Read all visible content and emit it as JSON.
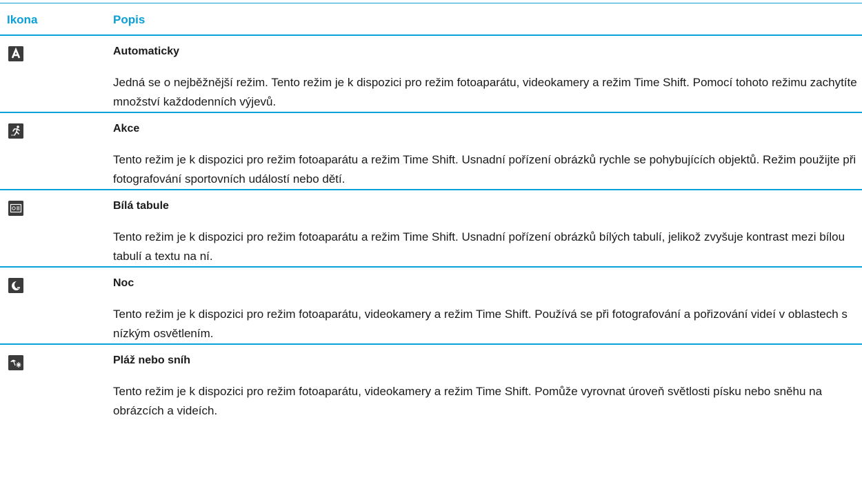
{
  "header": {
    "icon_col": "Ikona",
    "desc_col": "Popis"
  },
  "colors": {
    "accent": "#0a9fd6",
    "icon_bg": "#3b3b3b"
  },
  "rows": [
    {
      "icon": "auto-mode-icon",
      "title": "Automaticky",
      "text": "Jedná se o nejběžnější režim. Tento režim je k dispozici pro režim fotoaparátu, videokamery a režim Time Shift. Pomocí tohoto režimu zachytíte množství každodenních výjevů."
    },
    {
      "icon": "action-mode-icon",
      "title": "Akce",
      "text": "Tento režim je k dispozici pro režim fotoaparátu a režim Time Shift. Usnadní pořízení obrázků rychle se pohybujících objektů. Režim použijte při fotografování sportovních událostí nebo dětí."
    },
    {
      "icon": "whiteboard-mode-icon",
      "title": "Bílá tabule",
      "text": "Tento režim je k dispozici pro režim fotoaparátu a režim Time Shift. Usnadní pořízení obrázků bílých tabulí, jelikož zvyšuje kontrast mezi bílou tabulí a textu na ní."
    },
    {
      "icon": "night-mode-icon",
      "title": "Noc",
      "text": "Tento režim je k dispozici pro režim fotoaparátu, videokamery a režim Time Shift. Používá se při fotografování a pořizování videí v oblastech s nízkým osvětlením."
    },
    {
      "icon": "beach-snow-mode-icon",
      "title": "Pláž nebo sníh",
      "text": "Tento režim je k dispozici pro režim fotoaparátu, videokamery a režim Time Shift. Pomůže vyrovnat úroveň světlosti písku nebo sněhu na obrázcích a videích."
    }
  ]
}
